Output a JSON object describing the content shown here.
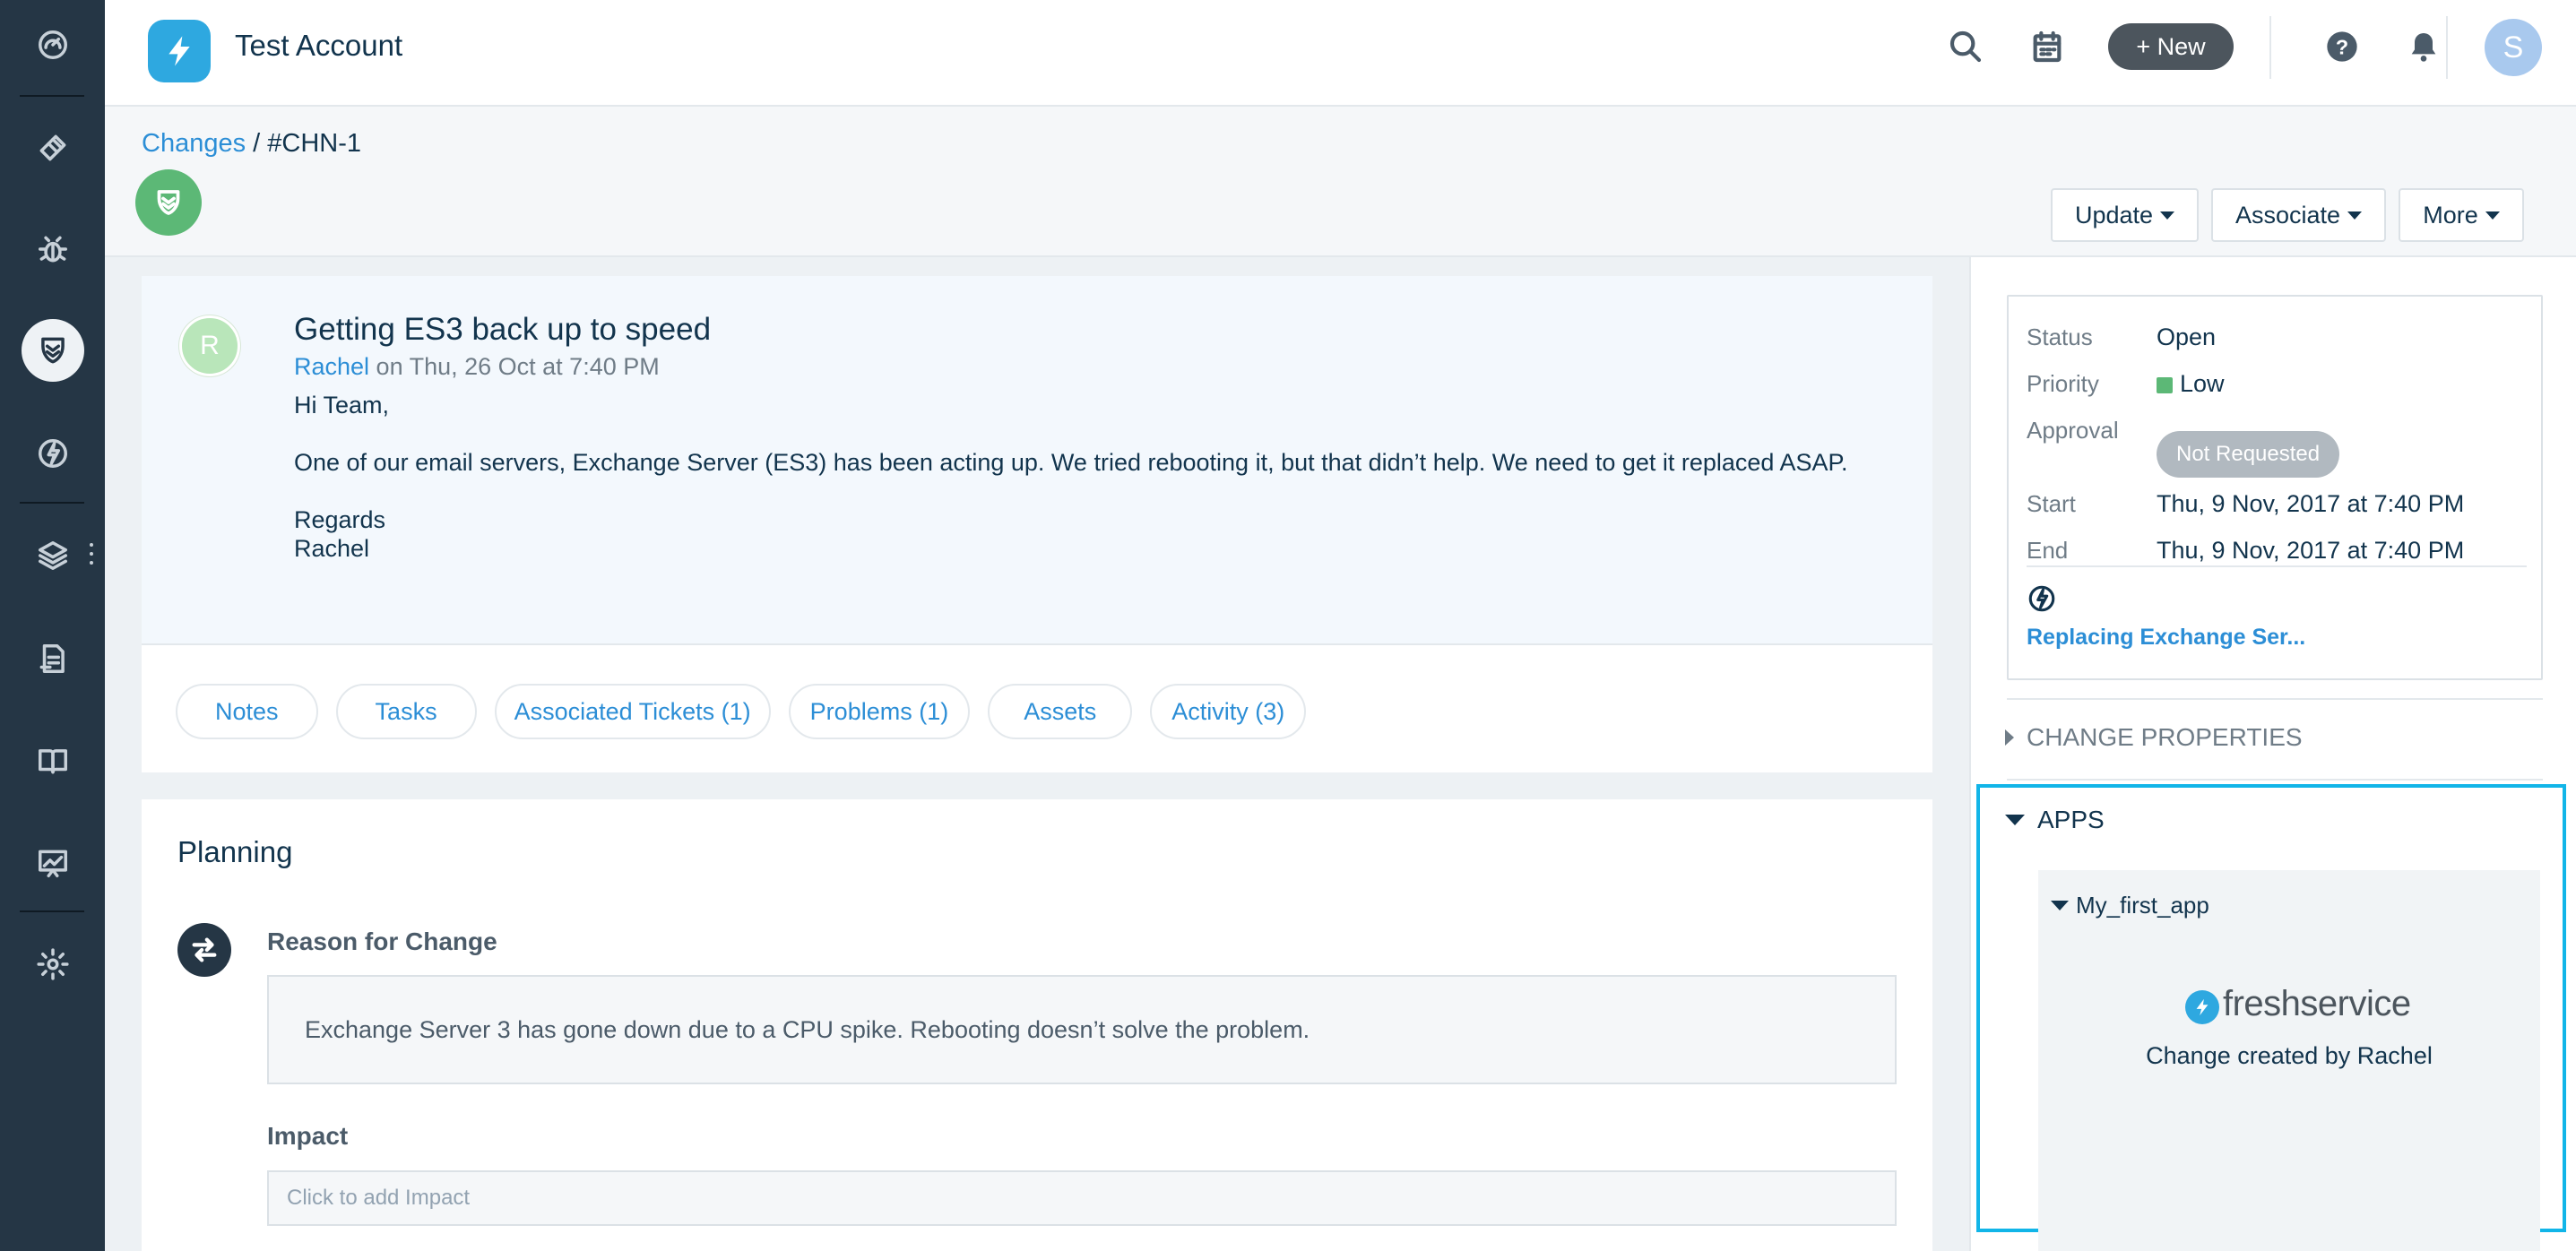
{
  "header": {
    "account_name": "Test Account",
    "new_button": "+ New",
    "avatar_initial": "S"
  },
  "sidenav": {
    "items": [
      "dashboard-icon",
      "tickets-icon",
      "problems-icon",
      "changes-icon",
      "releases-icon",
      "assets-icon",
      "contracts-icon",
      "solutions-icon",
      "reports-icon",
      "admin-icon"
    ],
    "active": "changes-icon"
  },
  "breadcrumb": {
    "link": "Changes",
    "separator": " / ",
    "current": "#CHN-1"
  },
  "actions": {
    "update": "Update",
    "associate": "Associate",
    "more": "More"
  },
  "ticket": {
    "requester_initial": "R",
    "title": "Getting ES3 back up to speed",
    "author": "Rachel",
    "timestamp": " on Thu, 26 Oct at 7:40 PM",
    "greeting": "Hi Team,",
    "body": "One of our email servers, Exchange Server (ES3) has been acting up. We tried rebooting it, but that didn’t help. We need to get it replaced ASAP.",
    "signoff": "Regards",
    "signature": "Rachel"
  },
  "tabs": [
    "Notes",
    "Tasks",
    "Associated Tickets  (1)",
    "Problems (1)",
    "Assets",
    "Activity  (3)"
  ],
  "planning": {
    "title": "Planning",
    "reason_label": "Reason for Change",
    "reason_text": "Exchange Server 3 has gone down due to a CPU spike. Rebooting doesn’t solve the problem.",
    "impact_label": "Impact",
    "impact_placeholder": "Click to add Impact"
  },
  "summary": {
    "status_label": "Status",
    "status_value": "Open",
    "priority_label": "Priority",
    "priority_value": "Low",
    "priority_color": "#5cb876",
    "approval_label": "Approval",
    "approval_value": "Not Requested",
    "start_label": "Start",
    "start_value": "Thu, 9 Nov, 2017 at 7:40 PM",
    "end_label": "End",
    "end_value": "Thu, 9 Nov, 2017 at 7:40 PM",
    "release_link": "Replacing Exchange Ser..."
  },
  "sections": {
    "change_properties": "CHANGE PROPERTIES",
    "apps": "APPS"
  },
  "app": {
    "name": "My_first_app",
    "brand": "freshservice",
    "message": "Change created by Rachel"
  },
  "colors": {
    "accent": "#2c8ed6",
    "highlight": "#11b5e8",
    "nav_bg": "#253645"
  }
}
